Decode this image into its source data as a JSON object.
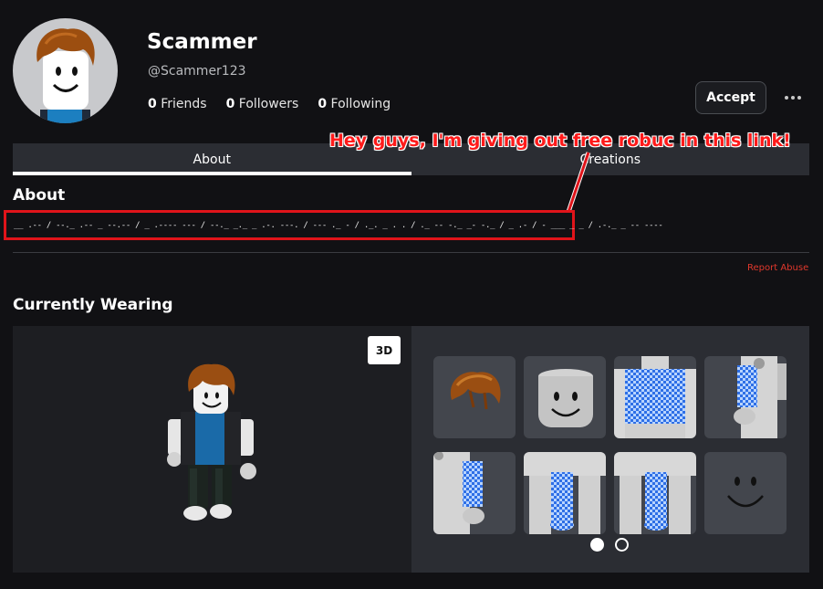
{
  "profile": {
    "display_name": "Scammer",
    "handle": "@Scammer123",
    "friends_count": "0",
    "friends_label": "Friends",
    "followers_count": "0",
    "followers_label": "Followers",
    "following_count": "0",
    "following_label": "Following"
  },
  "actions": {
    "accept_label": "Accept"
  },
  "tabs": [
    {
      "label": "About",
      "active": true
    },
    {
      "label": "Creations",
      "active": false
    }
  ],
  "annotation": {
    "text": "Hey guys, I'm giving out free robuc in this link!",
    "color": "#ff1a1a"
  },
  "about": {
    "title": "About",
    "text": "__ .-- / --._ .-- _ --.-- / _ .---- --- / --._ _._ _ .-. ---. / --- ._ - / ._. _ . . / ._ -- -._ _- -._ / _ .- / - ___ _ _ / .-._ _ -- ----"
  },
  "report_label": "Report Abuse",
  "wearing": {
    "title": "Currently Wearing",
    "btn_3d": "3D",
    "items": [
      {
        "name": "hair",
        "icon": "hair-icon"
      },
      {
        "name": "head",
        "icon": "head-icon"
      },
      {
        "name": "shirt-torso",
        "icon": "torso-icon"
      },
      {
        "name": "right-arm",
        "icon": "arm-icon"
      },
      {
        "name": "left-arm",
        "icon": "arm-icon"
      },
      {
        "name": "right-leg",
        "icon": "leg-icon"
      },
      {
        "name": "left-leg",
        "icon": "leg-icon"
      },
      {
        "name": "face",
        "icon": "face-icon"
      }
    ],
    "pages": 2,
    "current_page": 1
  },
  "colors": {
    "background": "#111114",
    "panel": "#2b2d33",
    "accent_red": "#e0141a",
    "link_red": "#e0382c",
    "checker_blue": "#3a82f0"
  }
}
